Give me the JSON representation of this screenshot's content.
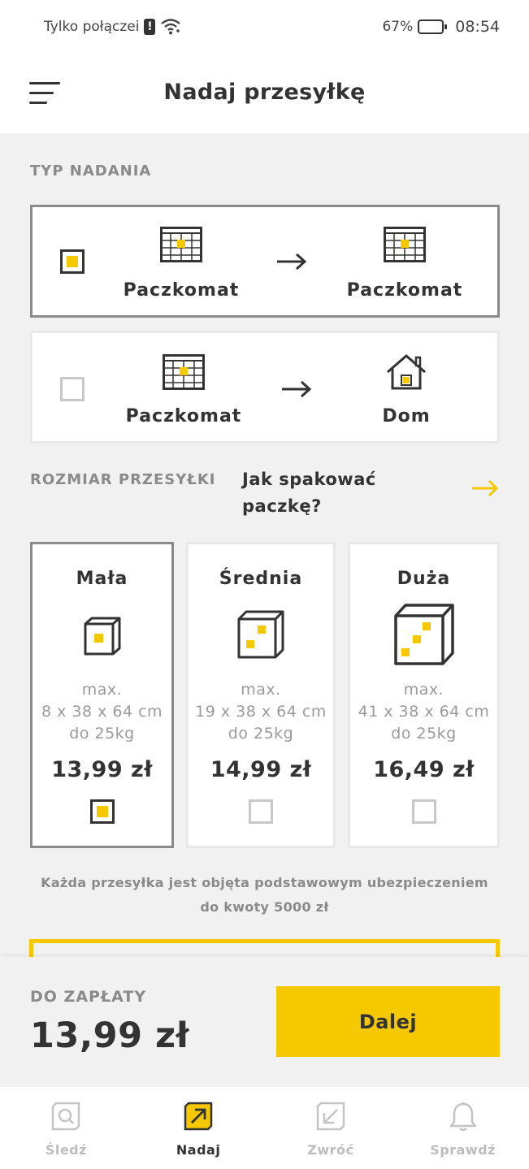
{
  "status_bar": {
    "carrier": "Tylko połączei",
    "battery": "67%",
    "battery_level": 0.67,
    "time": "08:54"
  },
  "header": {
    "title": "Nadaj przesyłkę"
  },
  "shipping_type": {
    "label": "TYP NADANIA",
    "options": [
      {
        "from": "Paczkomat",
        "to": "Paczkomat",
        "from_icon": "parcel-locker-icon",
        "to_icon": "parcel-locker-icon",
        "selected": true
      },
      {
        "from": "Paczkomat",
        "to": "Dom",
        "from_icon": "parcel-locker-icon",
        "to_icon": "house-icon",
        "selected": false
      }
    ]
  },
  "package_size": {
    "label": "ROZMIAR PRZESYŁKI",
    "pack_link": "Jak spakować paczkę?",
    "sizes": [
      {
        "name": "Mała",
        "dims_line1": "max.",
        "dims_line2": "8 x 38 x 64 cm",
        "dims_line3": "do 25kg",
        "price": "13,99 zł",
        "selected": true
      },
      {
        "name": "Średnia",
        "dims_line1": "max.",
        "dims_line2": "19 x 38 x 64 cm",
        "dims_line3": "do 25kg",
        "price": "14,99 zł",
        "selected": false
      },
      {
        "name": "Duża",
        "dims_line1": "max.",
        "dims_line2": "41 x 38 x 64 cm",
        "dims_line3": "do 25kg",
        "price": "16,49 zł",
        "selected": false
      }
    ],
    "insurance_note": "Każda przesyłka jest objęta podstawowym ubezpieczeniem do kwoty 5000 zł"
  },
  "payment": {
    "label": "DO ZAPŁATY",
    "amount": "13,99 zł",
    "next_label": "Dalej"
  },
  "bottom_nav": {
    "items": [
      {
        "label": "Śledź",
        "icon": "track-icon",
        "active": false
      },
      {
        "label": "Nadaj",
        "icon": "send-icon",
        "active": true
      },
      {
        "label": "Zwróć",
        "icon": "return-icon",
        "active": false
      },
      {
        "label": "Sprawdź",
        "icon": "bell-icon",
        "active": false
      }
    ]
  },
  "colors": {
    "accent": "#f5c800",
    "text": "#333333",
    "muted": "#8a8a8a",
    "background": "#f1f1f1"
  }
}
